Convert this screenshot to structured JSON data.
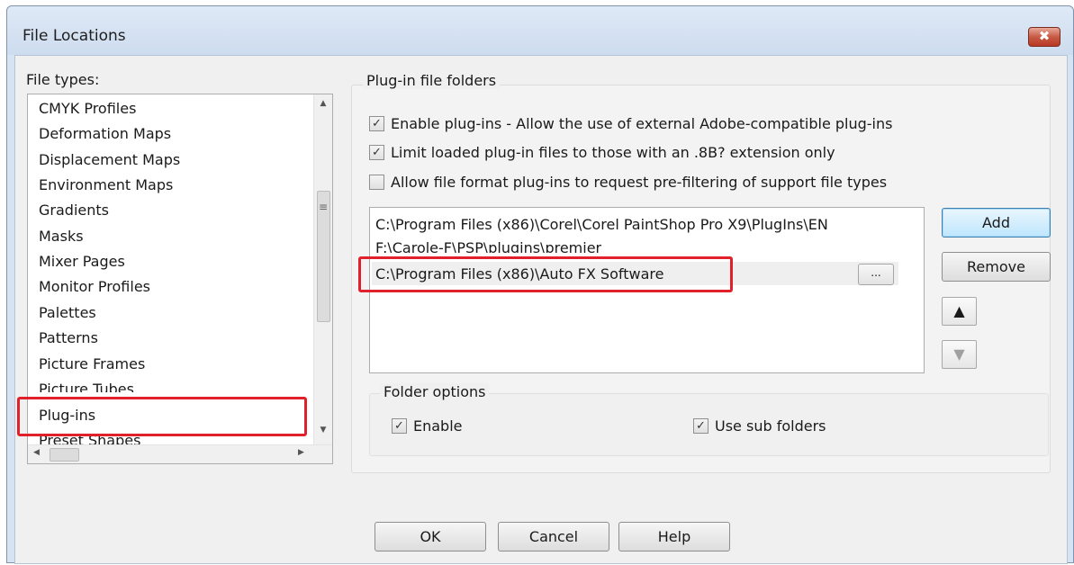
{
  "window": {
    "title": "File Locations",
    "close_symbol": "✖"
  },
  "file_types": {
    "label": "File types:",
    "items": [
      "CMYK Profiles",
      "Deformation Maps",
      "Displacement Maps",
      "Environment Maps",
      "Gradients",
      "Masks",
      "Mixer Pages",
      "Monitor Profiles",
      "Palettes",
      "Patterns",
      "Picture Frames",
      "Picture Tubes",
      "Plug-ins",
      "Preset Shapes"
    ],
    "selected": "Plug-ins"
  },
  "plugin_folders": {
    "title": "Plug-in file folders",
    "checks": [
      {
        "label": "Enable plug-ins - Allow the use of external Adobe-compatible plug-ins",
        "checked": true
      },
      {
        "label": "Limit loaded plug-in files to those with an .8B? extension only",
        "checked": true
      },
      {
        "label": "Allow file format plug-ins to request pre-filtering of support file types",
        "checked": false
      }
    ],
    "paths": [
      "C:\\Program Files (x86)\\Corel\\Corel PaintShop Pro X9\\PlugIns\\EN",
      "F:\\Carole-F\\PSP\\plugins\\premier",
      "C:\\Program Files (x86)\\Auto FX Software"
    ],
    "browse_label": "...",
    "add_label": "Add",
    "remove_label": "Remove"
  },
  "folder_options": {
    "title": "Folder options",
    "enable_label": "Enable",
    "enable_checked": true,
    "subfolders_label": "Use sub folders",
    "subfolders_checked": true
  },
  "footer": {
    "ok_label": "OK",
    "cancel_label": "Cancel",
    "help_label": "Help"
  },
  "icons": {
    "check": "✓",
    "up": "▲",
    "down": "▼",
    "left": "◀",
    "right": "▶",
    "grip": "≡"
  },
  "colors": {
    "highlight": "#e0202a",
    "accent": "#3c7fb1"
  }
}
